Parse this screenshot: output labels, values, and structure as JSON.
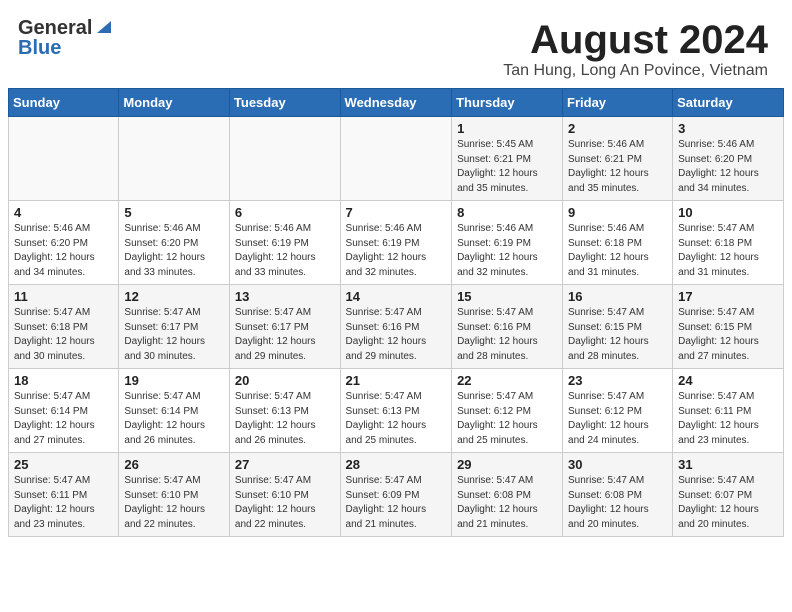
{
  "header": {
    "logo_general": "General",
    "logo_blue": "Blue",
    "title": "August 2024",
    "location": "Tan Hung, Long An Povince, Vietnam"
  },
  "calendar": {
    "days_of_week": [
      "Sunday",
      "Monday",
      "Tuesday",
      "Wednesday",
      "Thursday",
      "Friday",
      "Saturday"
    ],
    "weeks": [
      [
        {
          "day": "",
          "detail": ""
        },
        {
          "day": "",
          "detail": ""
        },
        {
          "day": "",
          "detail": ""
        },
        {
          "day": "",
          "detail": ""
        },
        {
          "day": "1",
          "detail": "Sunrise: 5:45 AM\nSunset: 6:21 PM\nDaylight: 12 hours\nand 35 minutes."
        },
        {
          "day": "2",
          "detail": "Sunrise: 5:46 AM\nSunset: 6:21 PM\nDaylight: 12 hours\nand 35 minutes."
        },
        {
          "day": "3",
          "detail": "Sunrise: 5:46 AM\nSunset: 6:20 PM\nDaylight: 12 hours\nand 34 minutes."
        }
      ],
      [
        {
          "day": "4",
          "detail": "Sunrise: 5:46 AM\nSunset: 6:20 PM\nDaylight: 12 hours\nand 34 minutes."
        },
        {
          "day": "5",
          "detail": "Sunrise: 5:46 AM\nSunset: 6:20 PM\nDaylight: 12 hours\nand 33 minutes."
        },
        {
          "day": "6",
          "detail": "Sunrise: 5:46 AM\nSunset: 6:19 PM\nDaylight: 12 hours\nand 33 minutes."
        },
        {
          "day": "7",
          "detail": "Sunrise: 5:46 AM\nSunset: 6:19 PM\nDaylight: 12 hours\nand 32 minutes."
        },
        {
          "day": "8",
          "detail": "Sunrise: 5:46 AM\nSunset: 6:19 PM\nDaylight: 12 hours\nand 32 minutes."
        },
        {
          "day": "9",
          "detail": "Sunrise: 5:46 AM\nSunset: 6:18 PM\nDaylight: 12 hours\nand 31 minutes."
        },
        {
          "day": "10",
          "detail": "Sunrise: 5:47 AM\nSunset: 6:18 PM\nDaylight: 12 hours\nand 31 minutes."
        }
      ],
      [
        {
          "day": "11",
          "detail": "Sunrise: 5:47 AM\nSunset: 6:18 PM\nDaylight: 12 hours\nand 30 minutes."
        },
        {
          "day": "12",
          "detail": "Sunrise: 5:47 AM\nSunset: 6:17 PM\nDaylight: 12 hours\nand 30 minutes."
        },
        {
          "day": "13",
          "detail": "Sunrise: 5:47 AM\nSunset: 6:17 PM\nDaylight: 12 hours\nand 29 minutes."
        },
        {
          "day": "14",
          "detail": "Sunrise: 5:47 AM\nSunset: 6:16 PM\nDaylight: 12 hours\nand 29 minutes."
        },
        {
          "day": "15",
          "detail": "Sunrise: 5:47 AM\nSunset: 6:16 PM\nDaylight: 12 hours\nand 28 minutes."
        },
        {
          "day": "16",
          "detail": "Sunrise: 5:47 AM\nSunset: 6:15 PM\nDaylight: 12 hours\nand 28 minutes."
        },
        {
          "day": "17",
          "detail": "Sunrise: 5:47 AM\nSunset: 6:15 PM\nDaylight: 12 hours\nand 27 minutes."
        }
      ],
      [
        {
          "day": "18",
          "detail": "Sunrise: 5:47 AM\nSunset: 6:14 PM\nDaylight: 12 hours\nand 27 minutes."
        },
        {
          "day": "19",
          "detail": "Sunrise: 5:47 AM\nSunset: 6:14 PM\nDaylight: 12 hours\nand 26 minutes."
        },
        {
          "day": "20",
          "detail": "Sunrise: 5:47 AM\nSunset: 6:13 PM\nDaylight: 12 hours\nand 26 minutes."
        },
        {
          "day": "21",
          "detail": "Sunrise: 5:47 AM\nSunset: 6:13 PM\nDaylight: 12 hours\nand 25 minutes."
        },
        {
          "day": "22",
          "detail": "Sunrise: 5:47 AM\nSunset: 6:12 PM\nDaylight: 12 hours\nand 25 minutes."
        },
        {
          "day": "23",
          "detail": "Sunrise: 5:47 AM\nSunset: 6:12 PM\nDaylight: 12 hours\nand 24 minutes."
        },
        {
          "day": "24",
          "detail": "Sunrise: 5:47 AM\nSunset: 6:11 PM\nDaylight: 12 hours\nand 23 minutes."
        }
      ],
      [
        {
          "day": "25",
          "detail": "Sunrise: 5:47 AM\nSunset: 6:11 PM\nDaylight: 12 hours\nand 23 minutes."
        },
        {
          "day": "26",
          "detail": "Sunrise: 5:47 AM\nSunset: 6:10 PM\nDaylight: 12 hours\nand 22 minutes."
        },
        {
          "day": "27",
          "detail": "Sunrise: 5:47 AM\nSunset: 6:10 PM\nDaylight: 12 hours\nand 22 minutes."
        },
        {
          "day": "28",
          "detail": "Sunrise: 5:47 AM\nSunset: 6:09 PM\nDaylight: 12 hours\nand 21 minutes."
        },
        {
          "day": "29",
          "detail": "Sunrise: 5:47 AM\nSunset: 6:08 PM\nDaylight: 12 hours\nand 21 minutes."
        },
        {
          "day": "30",
          "detail": "Sunrise: 5:47 AM\nSunset: 6:08 PM\nDaylight: 12 hours\nand 20 minutes."
        },
        {
          "day": "31",
          "detail": "Sunrise: 5:47 AM\nSunset: 6:07 PM\nDaylight: 12 hours\nand 20 minutes."
        }
      ]
    ]
  }
}
